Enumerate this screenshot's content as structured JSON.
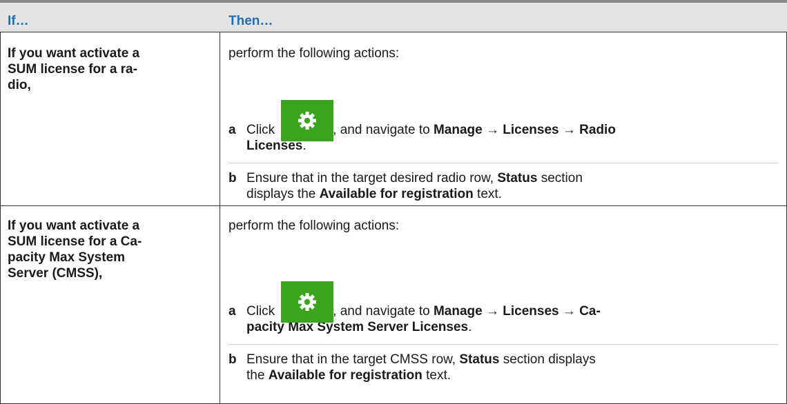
{
  "header": {
    "if_label": "If…",
    "then_label": "Then…"
  },
  "rows": [
    {
      "if_lines": [
        "If you want activate a",
        "SUM license for a ra-",
        "dio,"
      ],
      "lead": "perform the following actions:",
      "steps": [
        {
          "letter": "a",
          "click_word": "Click",
          "after_icon": ", and navigate to",
          "path_1": "Manage",
          "arrow": "→",
          "path_2": "Licenses",
          "path_3_line1": "Radio",
          "path_3_line2": "Licenses",
          "end": "."
        },
        {
          "letter": "b",
          "text_1": "Ensure that in the target desired radio row,",
          "bold_1": "Status",
          "text_2": "section",
          "text_3": "displays the",
          "bold_2": "Available for registration",
          "text_4": "text."
        }
      ]
    },
    {
      "if_lines": [
        "If you want activate a",
        "SUM license for a Ca-",
        "pacity Max System",
        "Server (CMSS),"
      ],
      "lead": "perform the following actions:",
      "steps": [
        {
          "letter": "a",
          "click_word": "Click",
          "after_icon": ", and navigate to",
          "path_1": "Manage",
          "arrow": "→",
          "path_2": "Licenses",
          "path_3_line1": "Ca-",
          "path_3_line2": "pacity Max System Server Licenses",
          "end": "."
        },
        {
          "letter": "b",
          "text_1": "Ensure that in the target CMSS row,",
          "bold_1": "Status",
          "text_2": "section displays",
          "text_3": "the",
          "bold_2": "Available for registration",
          "text_4": "text."
        }
      ]
    }
  ],
  "icon": {
    "name": "gear-icon",
    "bg_color": "#3aa41d",
    "fg_color": "#ffffff"
  }
}
